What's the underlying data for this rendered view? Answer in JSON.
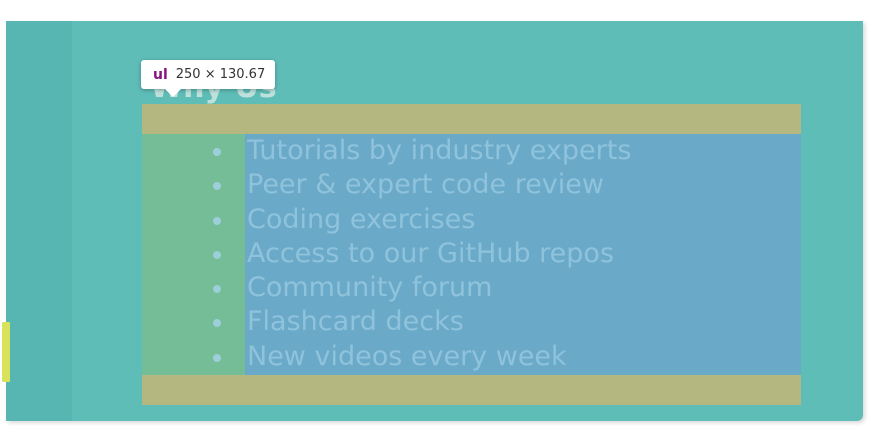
{
  "heading": "Why Us",
  "tooltip": {
    "tag": "ul",
    "dimensions": "250 × 130.67"
  },
  "list": {
    "items": [
      "Tutorials by industry experts",
      "Peer & expert code review",
      "Coding exercises",
      "Access to our GitHub repos",
      "Community forum",
      "Flashcard decks",
      "New videos every week"
    ]
  },
  "colors": {
    "page_background": "#5fbdb8",
    "margin_overlay": "#b5b781",
    "padding_overlay": "#74bd96",
    "content_overlay": "#6ba9c9",
    "list_text": "#8ec3db",
    "tooltip_tag": "#881280"
  }
}
